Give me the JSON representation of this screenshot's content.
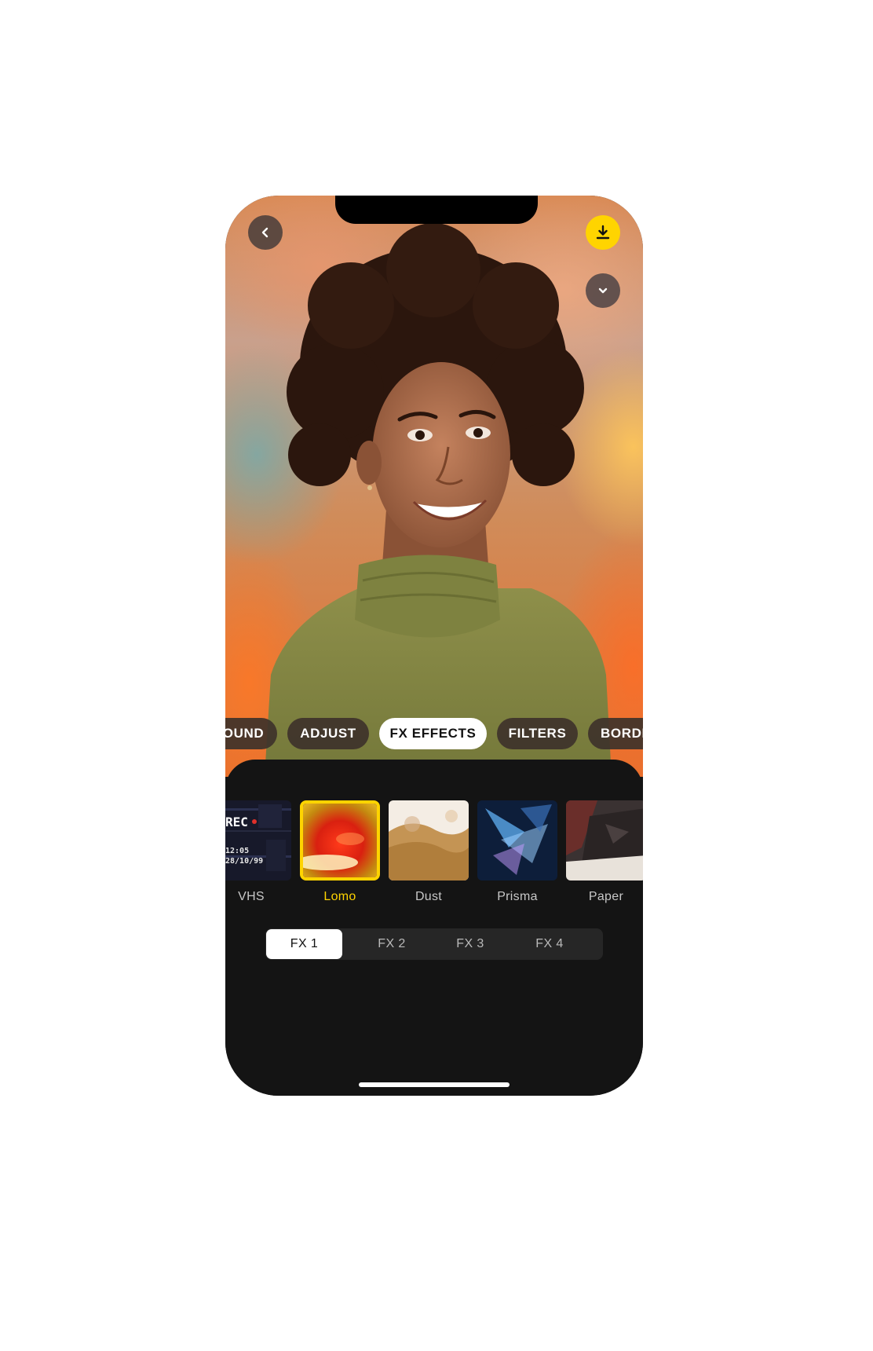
{
  "app": {
    "accent_color": "#ffd400"
  },
  "top_controls": {
    "back_icon": "chevron-left-icon",
    "download_icon": "download-icon",
    "collapse_icon": "chevron-down-icon"
  },
  "category_tabs": [
    {
      "label": "OUND",
      "active": false
    },
    {
      "label": "ADJUST",
      "active": false
    },
    {
      "label": "FX EFFECTS",
      "active": true
    },
    {
      "label": "FILTERS",
      "active": false
    },
    {
      "label": "BORDI",
      "active": false
    }
  ],
  "effects": [
    {
      "label": "VHS",
      "selected": false
    },
    {
      "label": "Lomo",
      "selected": true
    },
    {
      "label": "Dust",
      "selected": false
    },
    {
      "label": "Prisma",
      "selected": false
    },
    {
      "label": "Paper",
      "selected": false
    }
  ],
  "vhs_overlay": {
    "rec": "REC",
    "time": "12:05",
    "date": "28/10/99"
  },
  "fx_segments": [
    {
      "label": "FX 1",
      "active": true
    },
    {
      "label": "FX 2",
      "active": false
    },
    {
      "label": "FX 3",
      "active": false
    },
    {
      "label": "FX 4",
      "active": false
    }
  ]
}
